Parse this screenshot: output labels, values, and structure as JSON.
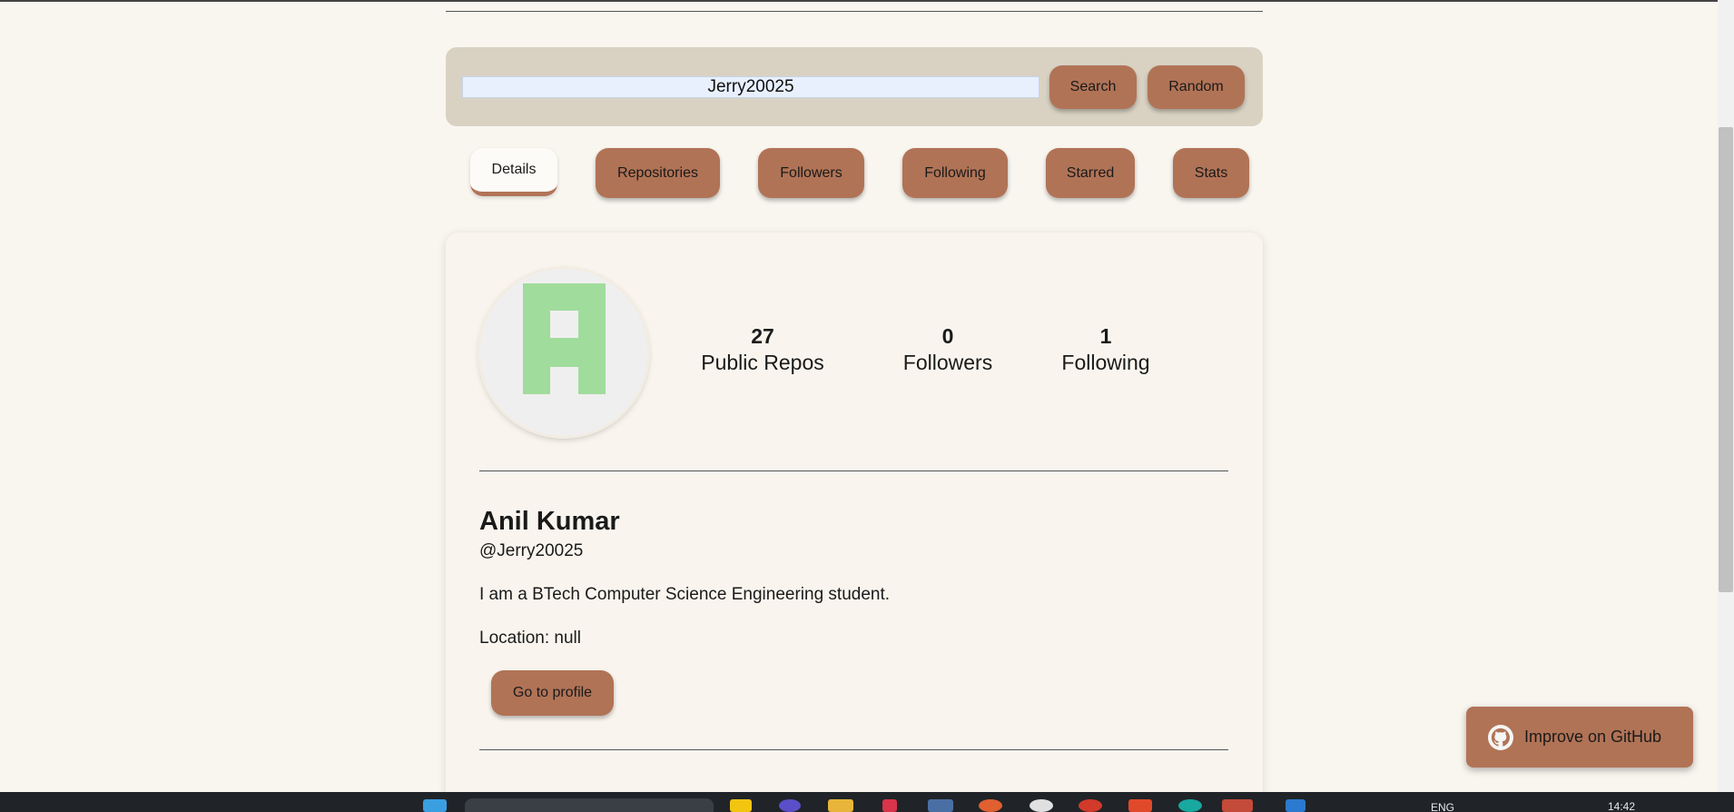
{
  "search": {
    "value": "Jerry20025",
    "search_label": "Search",
    "random_label": "Random"
  },
  "tabs": [
    {
      "label": "Details",
      "active": true
    },
    {
      "label": "Repositories"
    },
    {
      "label": "Followers"
    },
    {
      "label": "Following"
    },
    {
      "label": "Starred"
    },
    {
      "label": "Stats"
    }
  ],
  "profile": {
    "stats": [
      {
        "value": "27",
        "label": "Public Repos"
      },
      {
        "value": "0",
        "label": "Followers"
      },
      {
        "value": "1",
        "label": "Following"
      }
    ],
    "name": "Anil Kumar",
    "username": "@Jerry20025",
    "bio": "I am a BTech Computer Science Engineering student.",
    "location": "Location: null",
    "profile_button": "Go to profile"
  },
  "github_button": {
    "label": "Improve on GitHub",
    "icon": "github-icon"
  },
  "taskbar": {
    "language": "ENG",
    "time": "14:42"
  },
  "colors": {
    "background": "#f9f5ef",
    "accent": "#b17356",
    "panel": "#d9d2c3",
    "avatar_pattern": "#a0dc9c"
  }
}
